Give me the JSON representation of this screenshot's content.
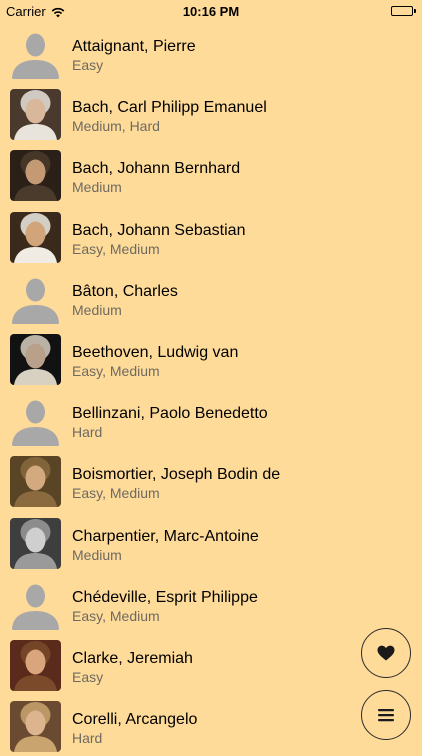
{
  "status_bar": {
    "carrier": "Carrier",
    "time": "10:16 PM",
    "wifi_icon": "wifi-icon",
    "battery_icon": "battery-full-icon"
  },
  "composers": [
    {
      "name": "Attaignant, Pierre",
      "level": "Easy",
      "portrait": "placeholder"
    },
    {
      "name": "Bach, Carl Philipp Emanuel",
      "level": "Medium, Hard",
      "portrait": "photo"
    },
    {
      "name": "Bach, Johann Bernhard",
      "level": "Medium",
      "portrait": "photo"
    },
    {
      "name": "Bach, Johann Sebastian",
      "level": "Easy, Medium",
      "portrait": "photo"
    },
    {
      "name": "Bâton, Charles",
      "level": "Medium",
      "portrait": "placeholder"
    },
    {
      "name": "Beethoven, Ludwig van",
      "level": "Easy, Medium",
      "portrait": "photo"
    },
    {
      "name": "Bellinzani, Paolo Benedetto",
      "level": "Hard",
      "portrait": "placeholder"
    },
    {
      "name": "Boismortier, Joseph Bodin de",
      "level": "Easy, Medium",
      "portrait": "photo"
    },
    {
      "name": "Charpentier, Marc-Antoine",
      "level": "Medium",
      "portrait": "photo"
    },
    {
      "name": "Chédeville, Esprit Philippe",
      "level": "Easy, Medium",
      "portrait": "placeholder"
    },
    {
      "name": "Clarke, Jeremiah",
      "level": "Easy",
      "portrait": "photo"
    },
    {
      "name": "Corelli, Arcangelo",
      "level": "Hard",
      "portrait": "photo"
    }
  ],
  "buttons": {
    "favorites_icon": "heart-icon",
    "menu_icon": "menu-icon"
  },
  "colors": {
    "background": "#ffdb9a",
    "secondary_text": "#6e6a60",
    "placeholder_silhouette": "#a8a8a8"
  }
}
